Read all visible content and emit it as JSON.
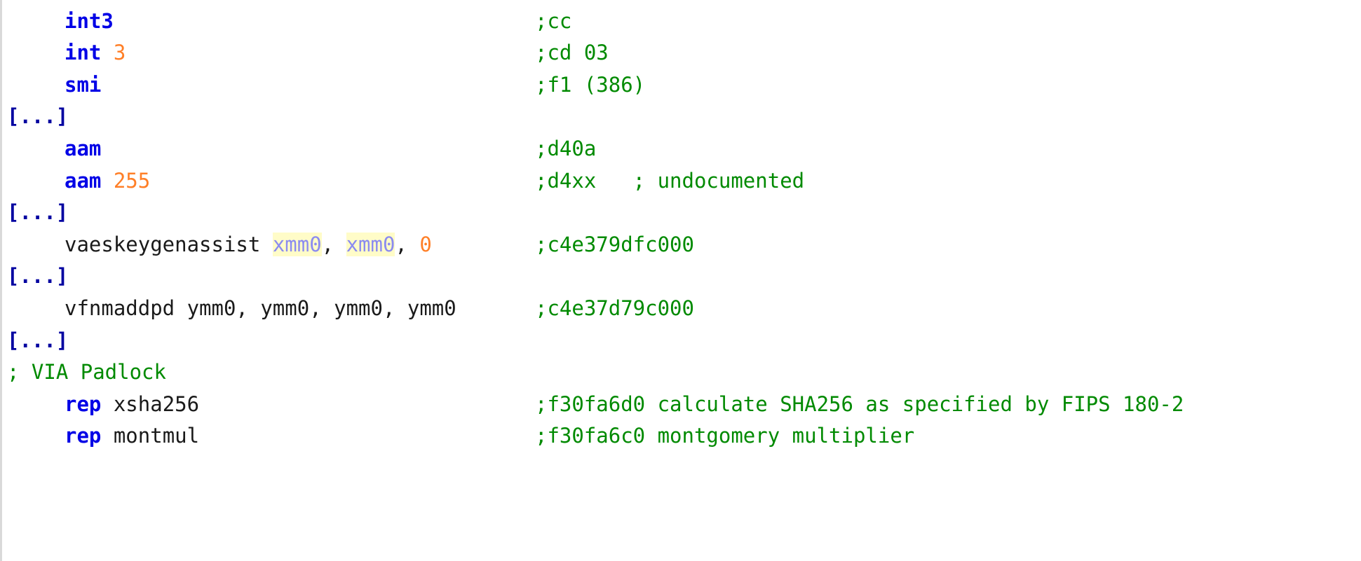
{
  "lines": [
    {
      "mnemonic": "int3",
      "comment": ";cc"
    },
    {
      "mnemonic": "int",
      "operand": " 3",
      "comment": ";cd 03"
    },
    {
      "mnemonic": "smi",
      "comment": ";f1 (386)"
    },
    {
      "ellipsis": "[...]"
    },
    {
      "mnemonic": "aam",
      "comment": ";d40a"
    },
    {
      "mnemonic": "aam",
      "operand": " 255",
      "comment": ";d4xx   ; undocumented"
    },
    {
      "ellipsis": "[...]"
    },
    {
      "mnemonic": "vaeskeygenassist ",
      "reg1": "xmm0",
      "sep1": ", ",
      "reg2": "xmm0",
      "sep2": ", ",
      "imm": "0",
      "comment": ";c4e379dfc000"
    },
    {
      "ellipsis": "[...]"
    },
    {
      "mnemonic": "vfnmaddpd ymm0, ymm0, ymm0, ymm0 ",
      "comment": ";c4e37d79c000"
    },
    {
      "ellipsis": "[...]"
    },
    {
      "section_comment": "; VIA Padlock"
    },
    {
      "prefix": "rep",
      "mnemonic": " xsha256",
      "comment": ";f30fa6d0 calculate SHA256 as specified by FIPS 180-2"
    },
    {
      "prefix": "rep",
      "mnemonic": " montmul",
      "comment": ";f30fa6c0 montgomery multiplier"
    }
  ],
  "colors": {
    "keyword": "#0000e6",
    "number": "#ff7f27",
    "comment": "#008a00",
    "highlight_bg": "#fffcc8",
    "highlight_fg": "#8b8bf0",
    "bracket": "#0000a0"
  }
}
